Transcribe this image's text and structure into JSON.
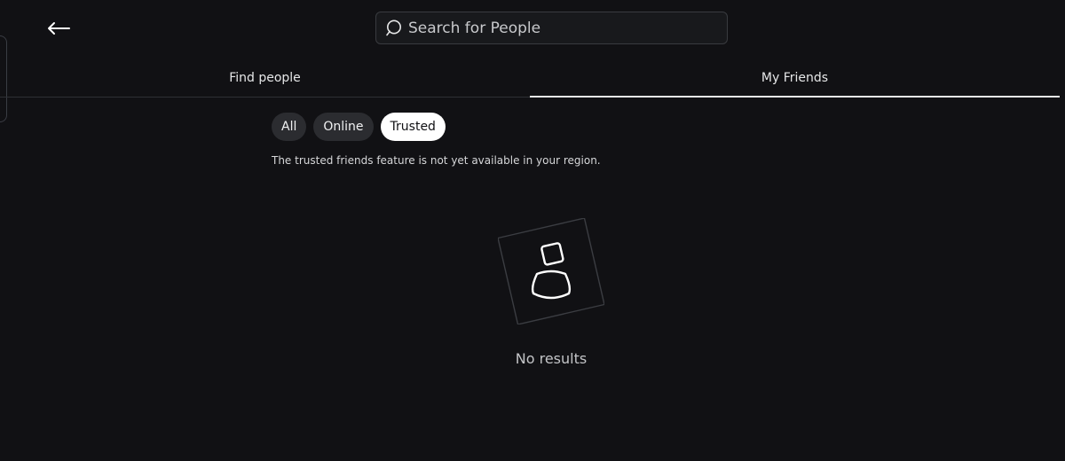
{
  "search": {
    "placeholder": "Search for People",
    "value": ""
  },
  "tabs": [
    {
      "label": "Find people",
      "active": false
    },
    {
      "label": "My Friends",
      "active": true
    }
  ],
  "filters": [
    {
      "label": "All",
      "selected": false
    },
    {
      "label": "Online",
      "selected": false
    },
    {
      "label": "Trusted",
      "selected": true
    }
  ],
  "notice": "The trusted friends feature is not yet available in your region.",
  "empty_state": {
    "message": "No results",
    "icon": "person-placeholder-icon"
  },
  "icons": {
    "back": "back-arrow-icon",
    "search": "search-icon"
  },
  "colors": {
    "background": "#111114",
    "chip": "#2b2c30",
    "chip_selected": "#ffffff"
  }
}
